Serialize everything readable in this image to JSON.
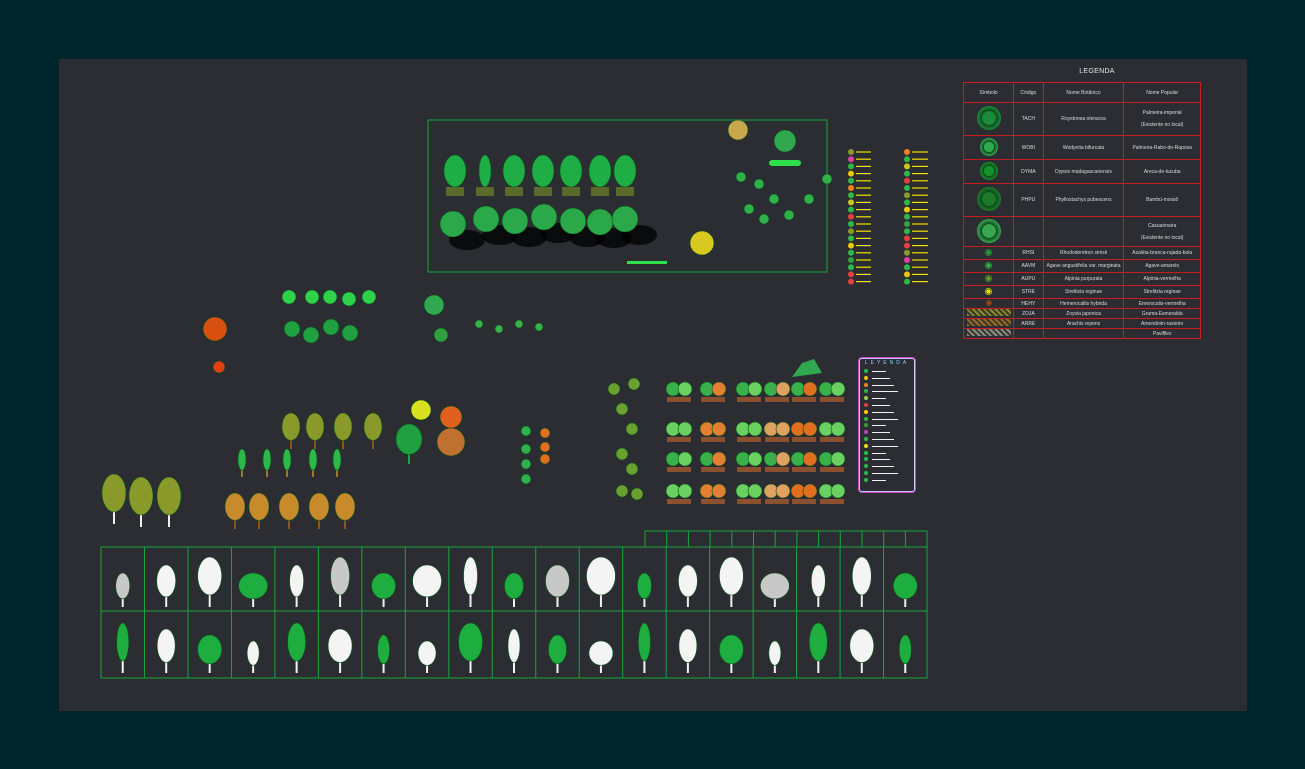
{
  "legend": {
    "title": "LEGENDA",
    "headers": [
      "Símbolo",
      "Código",
      "Nome Botânico",
      "Nome Popular"
    ],
    "rows": [
      {
        "code": "TACH",
        "botanical": "Roystonea oleracea",
        "popular": "Palmeira-imperial",
        "popular2": "(Existente no local)",
        "icon": "palm-top-icon",
        "color": "#1b8a3a"
      },
      {
        "code": "WOBI",
        "botanical": "Wodyetia bifurcata",
        "popular": "Palmeira-Rabo-de-Raposa",
        "popular2": "",
        "icon": "foxtail-palm-icon",
        "color": "#2fa84f"
      },
      {
        "code": "DYMA",
        "botanical": "Dypsis madagascariensis",
        "popular": "Areca-de-lucuba",
        "popular2": "",
        "icon": "areca-palm-icon",
        "color": "#16902c"
      },
      {
        "code": "PHPU",
        "botanical": "Phyllostachys pubescens",
        "popular": "Bambú-mossô",
        "popular2": "",
        "icon": "bamboo-icon",
        "color": "#1e7a2a"
      },
      {
        "code": "",
        "botanical": "",
        "popular": "Casuarinaira",
        "popular2": "(Existente no local)",
        "icon": "casuarina-icon",
        "color": "#3aa655"
      },
      {
        "code": "RHSI",
        "botanical": "Rhododendron simsii",
        "popular": "Azaléia-branca-rajada-bola",
        "popular2": "",
        "icon": "azalea-icon",
        "color": "#2b9b3d"
      },
      {
        "code": "AAVM",
        "botanical": "Agave angustifolia var. marginata",
        "popular": "Agave-amarelo",
        "popular2": "",
        "icon": "agave-icon",
        "color": "#35b04a"
      },
      {
        "code": "AUPU",
        "botanical": "Alpinia purpurata",
        "popular": "Alpinia-vermelha",
        "popular2": "",
        "icon": "alpinia-icon",
        "color": "#6a9a2a"
      },
      {
        "code": "STRE",
        "botanical": "Strelitzia reginae",
        "popular": "Strelitzia reginae",
        "popular2": "",
        "icon": "strelitzia-icon",
        "color": "#f2e600"
      },
      {
        "code": "HEHY",
        "botanical": "Hemerocallis hybrida",
        "popular": "Emerocalis-vermelha",
        "popular2": "",
        "icon": "hemerocallis-icon",
        "color": "#d63a1a"
      },
      {
        "code": "ZOJA",
        "botanical": "Zoysia japonica",
        "popular": "Grama-Esmeralda",
        "popular2": "",
        "icon": "grass-hatch-icon",
        "color": "#8a8a2a"
      },
      {
        "code": "ARRE",
        "botanical": "Arachis repens",
        "popular": "Amendoim-rasteiro",
        "popular2": "",
        "icon": "groundcover-hatch-icon",
        "color": "#9a6a2a"
      },
      {
        "code": "",
        "botanical": "",
        "popular": "Pavifllex",
        "popular2": "",
        "icon": "paving-hatch-icon",
        "color": "#8a8a8a"
      }
    ]
  },
  "leyenda": {
    "title": "LEYENDA",
    "items": [
      {
        "color": "#2fb84a"
      },
      {
        "color": "#e8c800"
      },
      {
        "color": "#f08020"
      },
      {
        "color": "#2fb84a"
      },
      {
        "color": "#8fd050"
      },
      {
        "color": "#e04040"
      },
      {
        "color": "#ffcc00"
      },
      {
        "color": "#2fb84a"
      },
      {
        "color": "#3a9a3a"
      },
      {
        "color": "#c040c0"
      },
      {
        "color": "#2fb84a"
      },
      {
        "color": "#e8e000"
      },
      {
        "color": "#1ec83a"
      },
      {
        "color": "#2fb84a"
      },
      {
        "color": "#2fb84a"
      },
      {
        "color": "#2fb84a"
      },
      {
        "color": "#2fb84a"
      }
    ]
  },
  "colors": {
    "frame": "#00252b",
    "canvas": "#2b2d33",
    "grid_line": "#15a83a",
    "legend_border": "#c41f1f"
  }
}
